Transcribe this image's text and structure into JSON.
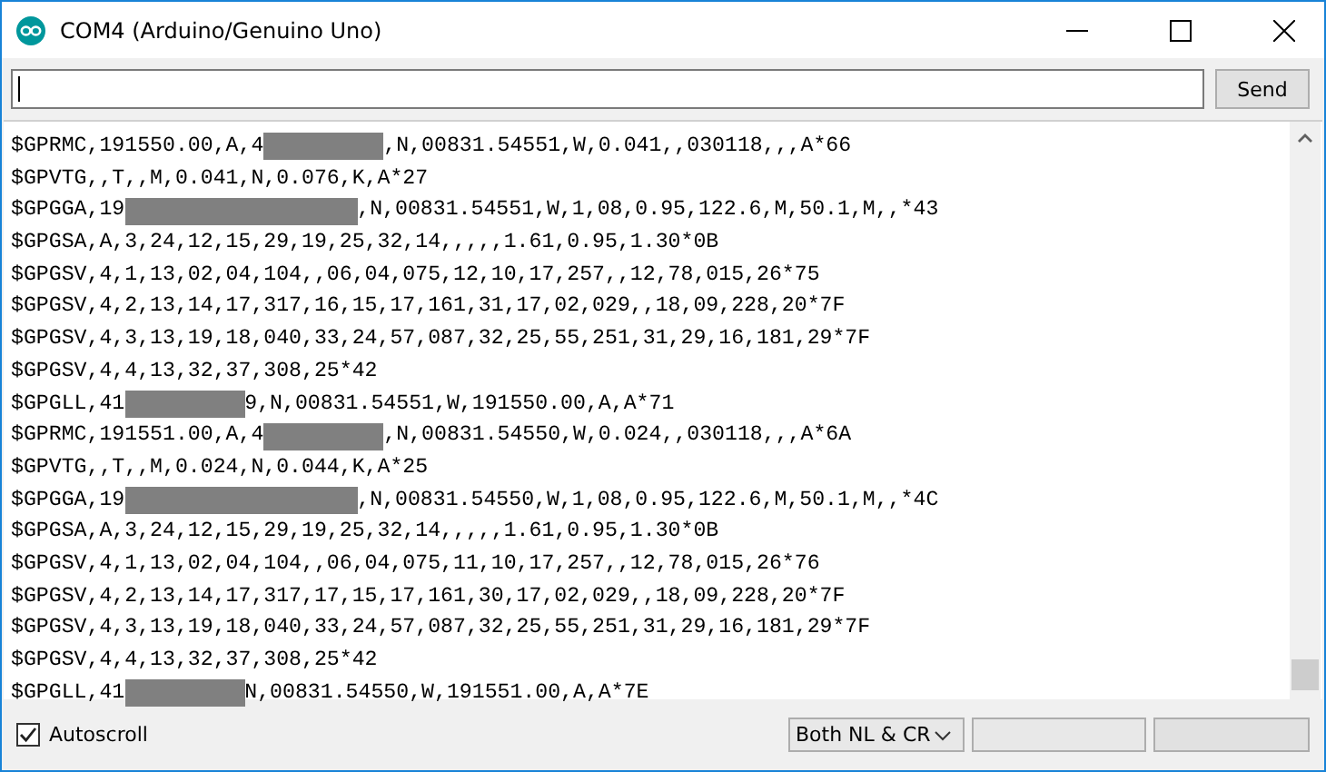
{
  "window": {
    "title": "COM4 (Arduino/Genuino Uno)"
  },
  "send": {
    "button": "Send"
  },
  "output": [
    {
      "segments": [
        {
          "kind": "text",
          "text": "$GPRMC,191550.00,A,4"
        },
        {
          "kind": "redaction"
        },
        {
          "kind": "text",
          "text": ",N,00831.54551,W,0.041,,030118,,,A*66"
        }
      ]
    },
    {
      "segments": [
        {
          "kind": "text",
          "text": "$GPVTG,,T,,M,0.041,N,0.076,K,A*27"
        }
      ]
    },
    {
      "segments": [
        {
          "kind": "text",
          "text": "$GPGGA,19"
        },
        {
          "kind": "redaction-long"
        },
        {
          "kind": "text",
          "text": ",N,00831.54551,W,1,08,0.95,122.6,M,50.1,M,,*43"
        }
      ]
    },
    {
      "segments": [
        {
          "kind": "text",
          "text": "$GPGSA,A,3,24,12,15,29,19,25,32,14,,,,,1.61,0.95,1.30*0B"
        }
      ]
    },
    {
      "segments": [
        {
          "kind": "text",
          "text": "$GPGSV,4,1,13,02,04,104,,06,04,075,12,10,17,257,,12,78,015,26*75"
        }
      ]
    },
    {
      "segments": [
        {
          "kind": "text",
          "text": "$GPGSV,4,2,13,14,17,317,16,15,17,161,31,17,02,029,,18,09,228,20*7F"
        }
      ]
    },
    {
      "segments": [
        {
          "kind": "text",
          "text": "$GPGSV,4,3,13,19,18,040,33,24,57,087,32,25,55,251,31,29,16,181,29*7F"
        }
      ]
    },
    {
      "segments": [
        {
          "kind": "text",
          "text": "$GPGSV,4,4,13,32,37,308,25*42"
        }
      ]
    },
    {
      "segments": [
        {
          "kind": "text",
          "text": "$GPGLL,41"
        },
        {
          "kind": "redaction"
        },
        {
          "kind": "text",
          "text": "9,N,00831.54551,W,191550.00,A,A*71"
        }
      ]
    },
    {
      "segments": [
        {
          "kind": "text",
          "text": "$GPRMC,191551.00,A,4"
        },
        {
          "kind": "redaction"
        },
        {
          "kind": "text",
          "text": ",N,00831.54550,W,0.024,,030118,,,A*6A"
        }
      ]
    },
    {
      "segments": [
        {
          "kind": "text",
          "text": "$GPVTG,,T,,M,0.024,N,0.044,K,A*25"
        }
      ]
    },
    {
      "segments": [
        {
          "kind": "text",
          "text": "$GPGGA,19"
        },
        {
          "kind": "redaction-long"
        },
        {
          "kind": "text",
          "text": ",N,00831.54550,W,1,08,0.95,122.6,M,50.1,M,,*4C"
        }
      ]
    },
    {
      "segments": [
        {
          "kind": "text",
          "text": "$GPGSA,A,3,24,12,15,29,19,25,32,14,,,,,1.61,0.95,1.30*0B"
        }
      ]
    },
    {
      "segments": [
        {
          "kind": "text",
          "text": "$GPGSV,4,1,13,02,04,104,,06,04,075,11,10,17,257,,12,78,015,26*76"
        }
      ]
    },
    {
      "segments": [
        {
          "kind": "text",
          "text": "$GPGSV,4,2,13,14,17,317,17,15,17,161,30,17,02,029,,18,09,228,20*7F"
        }
      ]
    },
    {
      "segments": [
        {
          "kind": "text",
          "text": "$GPGSV,4,3,13,19,18,040,33,24,57,087,32,25,55,251,31,29,16,181,29*7F"
        }
      ]
    },
    {
      "segments": [
        {
          "kind": "text",
          "text": "$GPGSV,4,4,13,32,37,308,25*42"
        }
      ]
    },
    {
      "segments": [
        {
          "kind": "text",
          "text": "$GPGLL,41"
        },
        {
          "kind": "redaction"
        },
        {
          "kind": "text",
          "text": "N,00831.54550,W,191551.00,A,A*7E"
        }
      ]
    }
  ],
  "footer": {
    "autoscroll": {
      "label": "Autoscroll",
      "checked": true
    },
    "line_ending": "Both NL & CR"
  }
}
